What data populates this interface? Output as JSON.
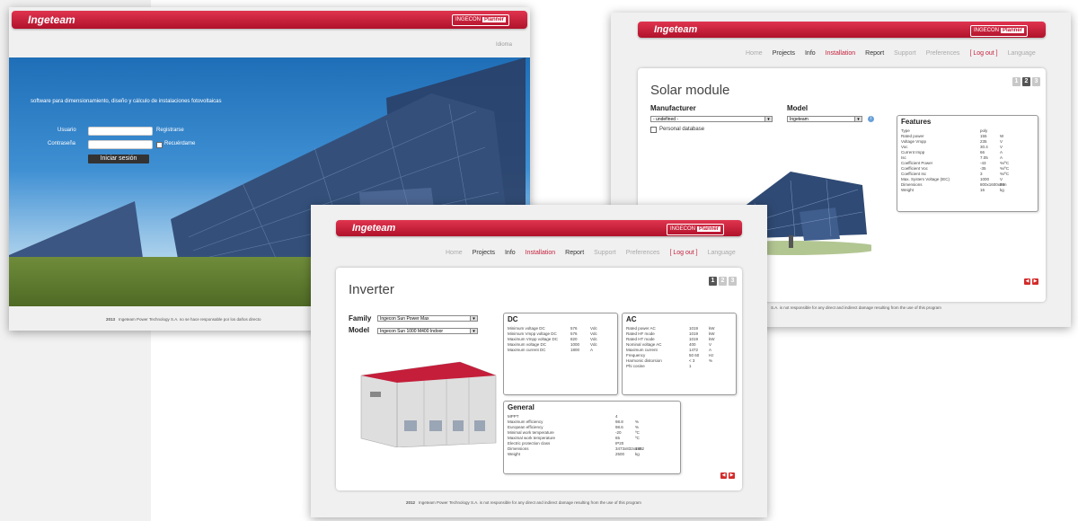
{
  "brand": {
    "logo": "Ingeteam",
    "badge": "INGECON",
    "badge_suffix": "Planner",
    "accent": "#c41e3a"
  },
  "login": {
    "language_label": "Idioma",
    "tagline": "software para dimensionamiento, diseño y cálculo de instalaciones fotovoltaicas",
    "user_label": "Usuario",
    "password_label": "Contraseña",
    "register_link": "Registrarse",
    "remember_label": "Recuérdame",
    "login_button": "Iniciar sesión",
    "footer_year": "2013",
    "footer_text": "Ingeteam Power Technology S.A. no se hace responsable por los daños directo"
  },
  "nav": {
    "home": "Home",
    "projects": "Projects",
    "info": "Info",
    "installation": "Installation",
    "report": "Report",
    "support": "Support",
    "preferences": "Preferences",
    "logout": "[ Log out ]",
    "language": "Language"
  },
  "steps": [
    "1",
    "2",
    "3"
  ],
  "arrows": {
    "prev": "◀",
    "next": "▶"
  },
  "solar": {
    "heading": "Solar module",
    "manufacturer_label": "Manufacturer",
    "manufacturer_value": "- undefined -",
    "model_label": "Model",
    "model_value": "Ingeteam",
    "personal_db_label": "Personal database",
    "features_title": "Features",
    "features": [
      {
        "k": "Type",
        "v": "poly",
        "u": ""
      },
      {
        "k": "Rated power",
        "v": "155",
        "u": "W"
      },
      {
        "k": "Voltage Vmpp",
        "v": "235",
        "u": "V"
      },
      {
        "k": "Voc",
        "v": "30.4",
        "u": "V"
      },
      {
        "k": "Current Impp",
        "v": "66",
        "u": "A"
      },
      {
        "k": "Isc",
        "v": "7.05",
        "u": "A"
      },
      {
        "k": "Coefficient Power",
        "v": "-43",
        "u": "%/ºC"
      },
      {
        "k": "Coefficient Voc",
        "v": "-35",
        "u": "%/ºC"
      },
      {
        "k": "Coefficient Isc",
        "v": "3",
        "u": "%/ºC"
      },
      {
        "k": "Max. System Voltage (IEC)",
        "v": "1000",
        "u": "V"
      },
      {
        "k": "Dimensions",
        "v": "800x1600x50",
        "u": "mm"
      },
      {
        "k": "Weight",
        "v": "16",
        "u": "kg"
      }
    ],
    "footer_text": "S.A. is not responsible for any direct and indirect damage resulting from the use of this program"
  },
  "inverter": {
    "heading": "Inverter",
    "family_label": "Family",
    "family_value": "Ingecon Sun Power Max",
    "model_label": "Model",
    "model_value": "Ingecon Sun 1000 M400 Indoor",
    "dc_title": "DC",
    "dc": [
      {
        "k": "Minimum voltage DC",
        "v": "576",
        "u": "Vdc"
      },
      {
        "k": "Minimum Vmpp voltage DC",
        "v": "576",
        "u": "Vdc"
      },
      {
        "k": "Maximum Vmpp voltage DC",
        "v": "820",
        "u": "Vdc"
      },
      {
        "k": "Maximum voltage DC",
        "v": "1000",
        "u": "Vdc"
      },
      {
        "k": "Maximum current DC",
        "v": "1800",
        "u": "A"
      }
    ],
    "ac_title": "AC",
    "ac": [
      {
        "k": "Rated power AC",
        "v": "1019",
        "u": "kW"
      },
      {
        "k": "Rated HF mode",
        "v": "1019",
        "u": "kW"
      },
      {
        "k": "Rated HT mode",
        "v": "1019",
        "u": "kW"
      },
      {
        "k": "Nominal voltage AC",
        "v": "400",
        "u": "V"
      },
      {
        "k": "Maximum current",
        "v": "1472",
        "u": "A"
      },
      {
        "k": "Frequency",
        "v": "50  60",
        "u": "Hz"
      },
      {
        "k": "Harmonic distorsion",
        "v": "< 3",
        "u": "%"
      },
      {
        "k": "Phi cosine",
        "v": "1",
        "u": ""
      }
    ],
    "general_title": "General",
    "general": [
      {
        "k": "MPPT",
        "v": "4",
        "u": ""
      },
      {
        "k": "Maximum efficiency",
        "v": "98.8",
        "u": "%"
      },
      {
        "k": "European efficiency",
        "v": "98.6",
        "u": "%"
      },
      {
        "k": "Minimal work temperature",
        "v": "-20",
        "u": "ºC"
      },
      {
        "k": "Maximal work temperature",
        "v": "65",
        "u": "ºC"
      },
      {
        "k": "Electric protection class",
        "v": "IP20",
        "u": ""
      },
      {
        "k": "Dimensions",
        "v": "3473x832x1882",
        "u": "mm"
      },
      {
        "k": "Weight",
        "v": "2500",
        "u": "kg"
      }
    ],
    "footer_year": "2012",
    "footer_text": "Ingeteam Power Technology S.A. is not responsible for any direct and indirect damage resulting from the use of this program"
  }
}
